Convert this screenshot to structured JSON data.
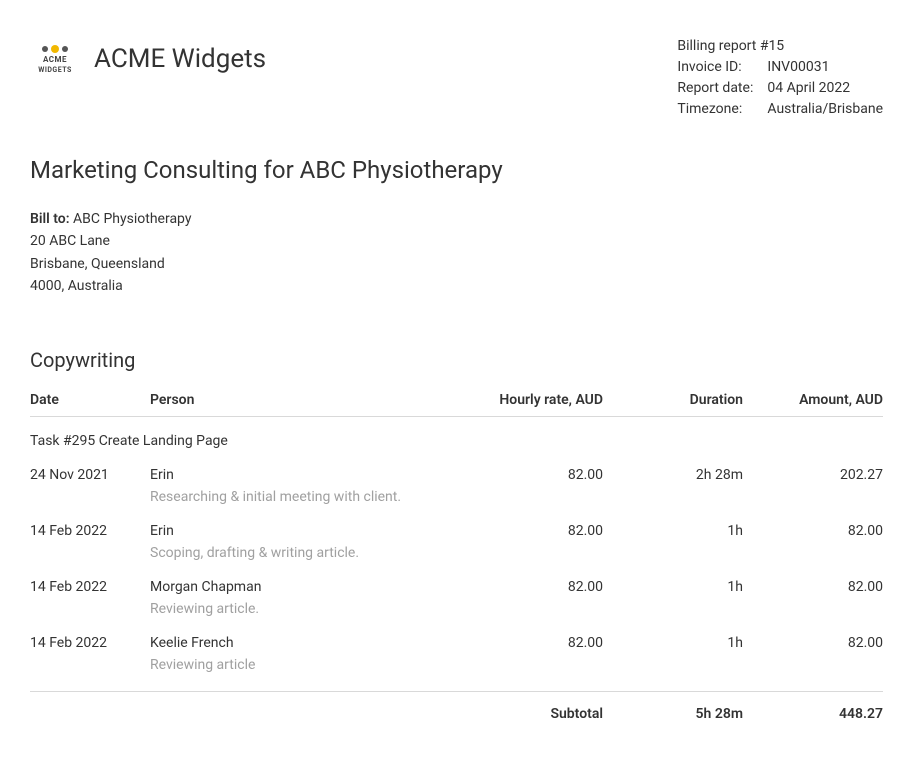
{
  "company": {
    "name": "ACME Widgets",
    "logo_line1": "ACME",
    "logo_line2": "WIDGETS"
  },
  "meta": {
    "title": "Billing report #15",
    "invoice_id_label": "Invoice ID:",
    "invoice_id": "INV00031",
    "report_date_label": "Report date:",
    "report_date": "04 April 2022",
    "timezone_label": "Timezone:",
    "timezone": "Australia/Brisbane"
  },
  "project_title": "Marketing Consulting for ABC Physiotherapy",
  "bill_to": {
    "label": "Bill to:",
    "name": "ABC Physiotherapy",
    "line1": "20 ABC Lane",
    "line2": "Brisbane, Queensland",
    "line3": "4000, Australia"
  },
  "section_title": "Copywriting",
  "columns": {
    "date": "Date",
    "person": "Person",
    "rate": "Hourly rate, AUD",
    "duration": "Duration",
    "amount": "Amount, AUD"
  },
  "task_title": "Task #295 Create Landing Page",
  "entries": [
    {
      "date": "24 Nov 2021",
      "person": "Erin",
      "rate": "82.00",
      "duration": "2h 28m",
      "amount": "202.27",
      "note": "Researching & initial meeting with client."
    },
    {
      "date": "14 Feb 2022",
      "person": "Erin",
      "rate": "82.00",
      "duration": "1h",
      "amount": "82.00",
      "note": "Scoping, drafting & writing article."
    },
    {
      "date": "14 Feb 2022",
      "person": "Morgan Chapman",
      "rate": "82.00",
      "duration": "1h",
      "amount": "82.00",
      "note": "Reviewing article."
    },
    {
      "date": "14 Feb 2022",
      "person": "Keelie French",
      "rate": "82.00",
      "duration": "1h",
      "amount": "82.00",
      "note": "Reviewing article"
    }
  ],
  "subtotal": {
    "label": "Subtotal",
    "duration": "5h 28m",
    "amount": "448.27"
  }
}
